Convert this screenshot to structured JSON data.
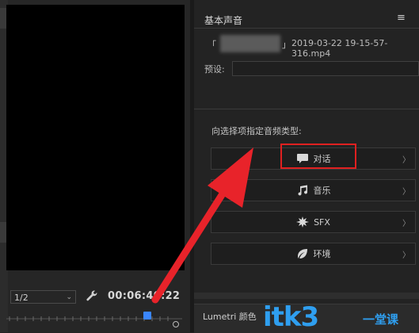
{
  "monitor": {
    "resolution": "1/2",
    "timecode": "00:06:40:22"
  },
  "essential_sound": {
    "title": "基本声音",
    "menu_icon": "≡",
    "clip_open_bracket": "「",
    "clip_close_bracket": "」",
    "clip_file": "2019-03-22 19-15-57-316.mp4",
    "preset_label": "预设:",
    "assign_prompt": "向选择项指定音频类型:",
    "types": [
      {
        "label": "对话",
        "icon": "speech-bubble-icon"
      },
      {
        "label": "音乐",
        "icon": "music-note-icon"
      },
      {
        "label": "SFX",
        "icon": "burst-icon"
      },
      {
        "label": "环境",
        "icon": "leaf-icon"
      }
    ],
    "chevron": "〉"
  },
  "lumetri": {
    "label": "Lumetri 颜色"
  },
  "watermark": {
    "text": "itk3",
    "sub": "一堂课"
  },
  "colors": {
    "highlight": "#e02020",
    "arrow": "#e8232a",
    "watermark": "#2f9ff0",
    "playhead": "#3a86ff"
  }
}
